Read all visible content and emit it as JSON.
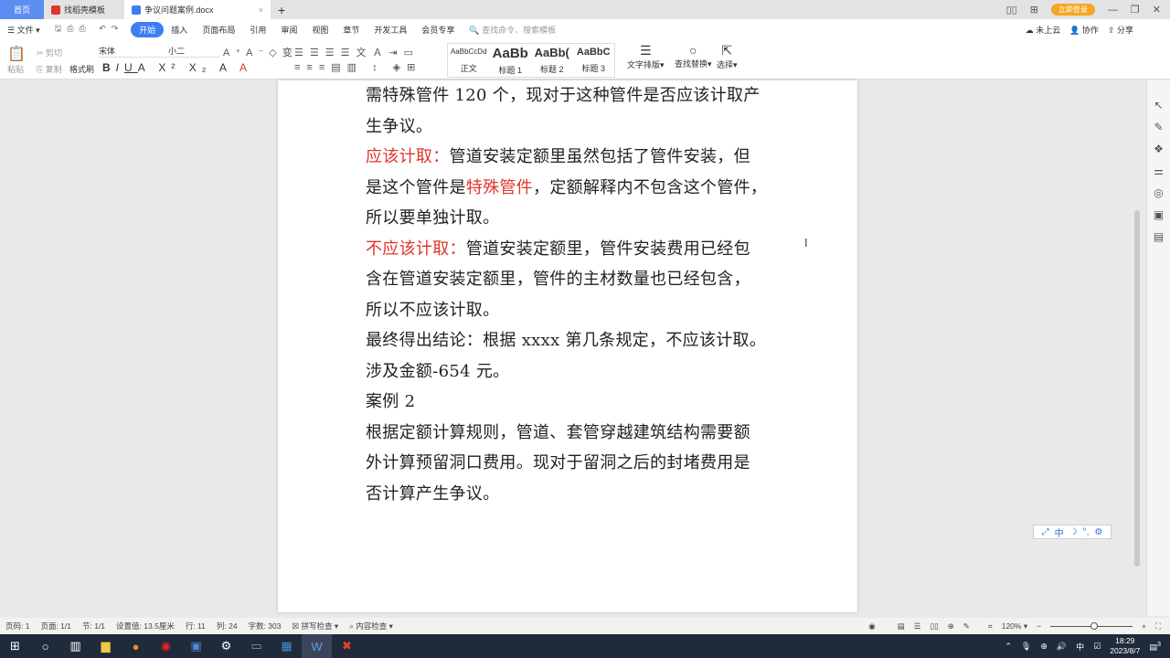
{
  "tabs": [
    {
      "label": "首页"
    },
    {
      "label": "找稻壳模板"
    },
    {
      "label": "争议问题案例.docx"
    }
  ],
  "vip_label": "立即登录",
  "menu": [
    "文件",
    "开始",
    "插入",
    "页面布局",
    "引用",
    "审阅",
    "视图",
    "章节",
    "开发工具",
    "会员专享"
  ],
  "search_placeholder": "查找命令、搜索模板",
  "top_right": {
    "cloud": "未上云",
    "collab": "协作",
    "share": "分享"
  },
  "ribbon": {
    "paste": "粘贴",
    "cut": "剪切",
    "copy": "复制",
    "format_painter": "格式刷",
    "font": "宋体",
    "size": "小二",
    "styles": [
      {
        "preview": "AaBbCcDd",
        "label": "正文"
      },
      {
        "preview": "AaBb",
        "label": "标题 1"
      },
      {
        "preview": "AaBb(",
        "label": "标题 2"
      },
      {
        "preview": "AaBbC",
        "label": "标题 3"
      }
    ],
    "text_layout": "文字排版",
    "find_replace": "查找替换",
    "select": "选择"
  },
  "doc_lines": [
    [
      {
        "t": "需特殊管件 120 个，现对于这种管件是否应该计取产"
      }
    ],
    [
      {
        "t": "生争议。"
      }
    ],
    [
      {
        "t": "应该计取：",
        "red": true
      },
      {
        "t": "管道安装定额里虽然包括了管件安装，但"
      }
    ],
    [
      {
        "t": "是这个管件是"
      },
      {
        "t": "特殊管件",
        "red": true
      },
      {
        "t": "，定额解释内不包含这个管件，"
      }
    ],
    [
      {
        "t": "所以要单独计取。"
      }
    ],
    [
      {
        "t": "不应该计取：",
        "red": true
      },
      {
        "t": "管道安装定额里，管件安装费用已经包"
      }
    ],
    [
      {
        "t": "含在管道安装定额里，管件的主材数量也已经包含，"
      }
    ],
    [
      {
        "t": "所以不应该计取。"
      }
    ],
    [
      {
        "t": "最终得出结论：根据 xxxx 第几条规定，不应该计取。"
      }
    ],
    [
      {
        "t": "涉及金额-654 元。"
      }
    ],
    [
      {
        "t": "案例 2"
      }
    ],
    [
      {
        "t": "根据定额计算规则，管道、套管穿越建筑结构需要额"
      }
    ],
    [
      {
        "t": "外计算预留洞口费用。现对于留洞之后的封堵费用是"
      }
    ],
    [
      {
        "t": "否计算产生争议。"
      }
    ]
  ],
  "status": {
    "page_no": "页码: 1",
    "pages": "页面: 1/1",
    "section": "节: 1/1",
    "setting": "设置值: 13.5厘米",
    "row": "行: 11",
    "col": "列: 24",
    "words": "字数: 303",
    "spell": "拼写检查",
    "content": "内容检查",
    "zoom": "120%"
  },
  "ime": "中",
  "clock": {
    "time": "18:29",
    "date": "2023/8/7"
  },
  "tray_ime": "中",
  "notifications": "3",
  "colors": {
    "accent": "#3d7ef5",
    "red": "#e0352b"
  }
}
